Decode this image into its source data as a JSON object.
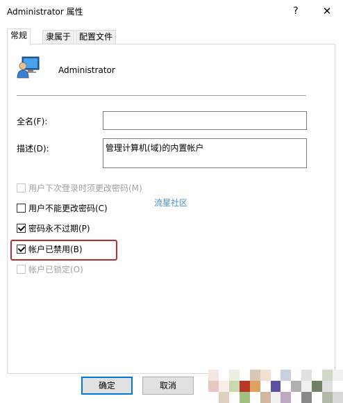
{
  "window": {
    "title": "Administrator 属性",
    "help_glyph": "?",
    "close_glyph": "✕"
  },
  "tabs": [
    {
      "label": "常规",
      "active": true
    },
    {
      "label": "隶属于",
      "active": false
    },
    {
      "label": "配置文件",
      "active": false
    }
  ],
  "user": {
    "name": "Administrator"
  },
  "form": {
    "fullname_label": "全名(F):",
    "fullname_value": "",
    "description_label": "描述(D):",
    "description_value": "管理计算机(域)的内置帐户"
  },
  "checkboxes": [
    {
      "label": "用户下次登录时须更改密码(M)",
      "checked": false,
      "enabled": false
    },
    {
      "label": "用户不能更改密码(C)",
      "checked": false,
      "enabled": true
    },
    {
      "label": "密码永不过期(P)",
      "checked": true,
      "enabled": true
    },
    {
      "label": "帐户已禁用(B)",
      "checked": true,
      "enabled": true
    },
    {
      "label": "帐户已锁定(O)",
      "checked": false,
      "enabled": false
    }
  ],
  "watermark": "流星社区",
  "buttons": {
    "ok": "确定",
    "cancel": "取消"
  },
  "colors": {
    "highlight_border": "#c0282e",
    "default_button_border": "#0078d7",
    "watermark": "#3f8fd8"
  }
}
